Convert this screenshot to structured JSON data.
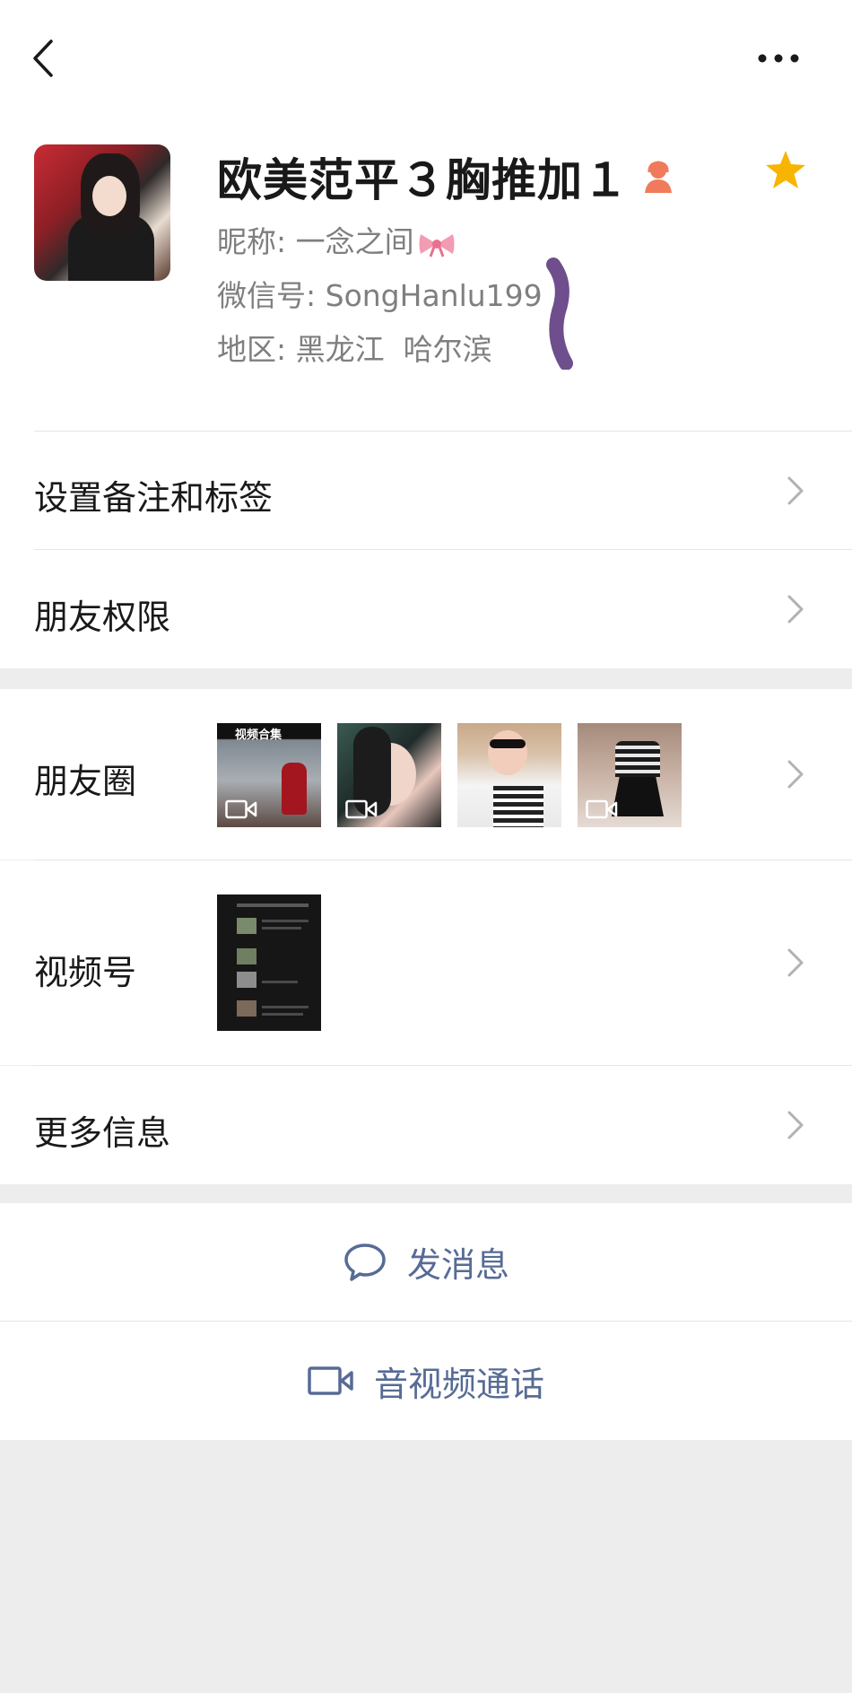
{
  "profile": {
    "remark_name": "欧美范平３胸推加１",
    "nickname_label": "昵称:",
    "nickname": "一念之间",
    "wechat_id_label": "微信号:",
    "wechat_id": "SongHanlu199",
    "region_label": "地区:",
    "region": "黑龙江  哈尔滨",
    "gender_icon": "female-person-icon",
    "starred": true
  },
  "menu": {
    "remark_tags": "设置备注和标签",
    "friend_permissions": "朋友权限",
    "moments": "朋友圈",
    "channels": "视频号",
    "more_info": "更多信息"
  },
  "moments": {
    "thumbnails": [
      {
        "name": "moment-thumb-1",
        "is_video": true,
        "caption": "视频合集"
      },
      {
        "name": "moment-thumb-2",
        "is_video": true
      },
      {
        "name": "moment-thumb-3",
        "is_video": false
      },
      {
        "name": "moment-thumb-4",
        "is_video": true
      }
    ]
  },
  "actions": {
    "send_message": "发消息",
    "video_call": "音视频通话"
  },
  "colors": {
    "link_blue": "#576b95",
    "star_yellow": "#f7b500",
    "gender_orange": "#f07b5c",
    "background": "#ededed"
  }
}
